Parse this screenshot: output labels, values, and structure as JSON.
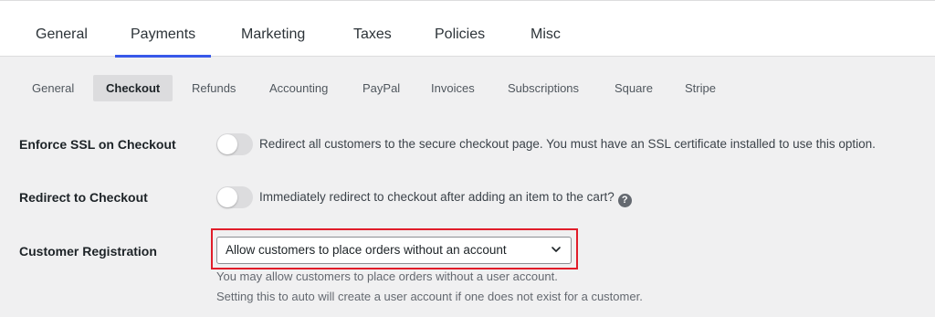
{
  "top_tabs": [
    {
      "label": "General",
      "active": false
    },
    {
      "label": "Payments",
      "active": true
    },
    {
      "label": "Marketing",
      "active": false
    },
    {
      "label": "Taxes",
      "active": false
    },
    {
      "label": "Policies",
      "active": false
    },
    {
      "label": "Misc",
      "active": false
    }
  ],
  "sub_tabs": [
    {
      "label": "General",
      "active": false
    },
    {
      "label": "Checkout",
      "active": true
    },
    {
      "label": "Refunds",
      "active": false
    },
    {
      "label": "Accounting",
      "active": false
    },
    {
      "label": "PayPal",
      "active": false
    },
    {
      "label": "Invoices",
      "active": false
    },
    {
      "label": "Subscriptions",
      "active": false
    },
    {
      "label": "Square",
      "active": false
    },
    {
      "label": "Stripe",
      "active": false
    }
  ],
  "settings": {
    "enforce_ssl": {
      "label": "Enforce SSL on Checkout",
      "enabled": false,
      "description": "Redirect all customers to the secure checkout page. You must have an SSL certificate installed to use this option."
    },
    "redirect_checkout": {
      "label": "Redirect to Checkout",
      "enabled": false,
      "description": "Immediately redirect to checkout after adding an item to the cart?",
      "help_icon": "?"
    },
    "customer_registration": {
      "label": "Customer Registration",
      "selected": "Allow customers to place orders without an account",
      "help_line_1": "You may allow customers to place orders without a user account.",
      "help_line_2": "Setting this to auto will create a user account if one does not exist for a customer."
    }
  },
  "colors": {
    "accent": "#3858e9",
    "highlight": "#e11d2a",
    "toggle_off": "#dcdcde"
  }
}
